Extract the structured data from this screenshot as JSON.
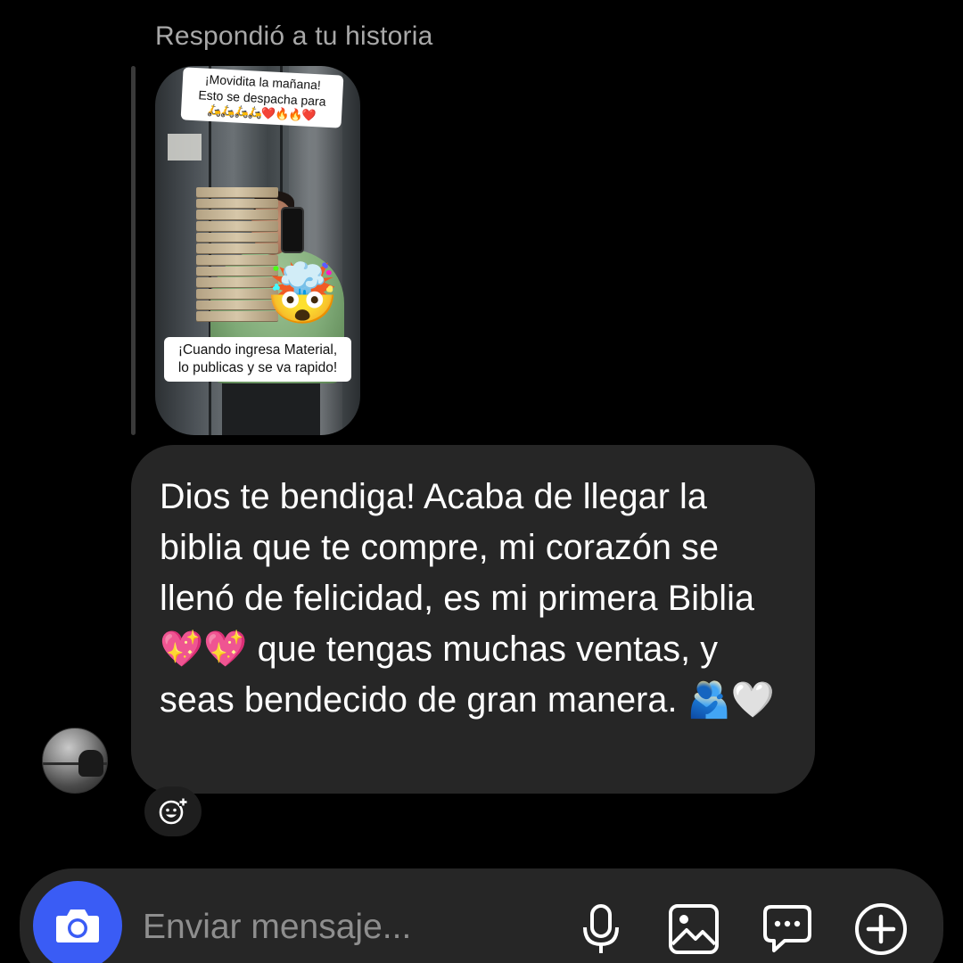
{
  "reply": {
    "header": "Respondió a tu historia"
  },
  "story": {
    "caption_top_line1": "¡Movidita la mañana!",
    "caption_top_line2": "Esto se despacha para",
    "caption_top_emojis": "🛵🛵🛵🛵❤️🔥🔥❤️",
    "caption_bottom_line1": "¡Cuando ingresa Material,",
    "caption_bottom_line2": "lo publicas y se va rapido!",
    "sticker_emoji": "🤯"
  },
  "message": {
    "text": "Dios te bendiga! Acaba de llegar la biblia que te compre, mi corazón se llenó de felicidad, es mi primera Biblia 💖💖 que tengas muchas ventas, y seas bendecido de gran manera. 🫂🤍"
  },
  "composer": {
    "placeholder": "Enviar mensaje..."
  },
  "icons": {
    "camera": "camera-icon",
    "microphone": "microphone-icon",
    "gallery": "gallery-icon",
    "sticker": "chat-bubble-icon",
    "add": "plus-circle-icon",
    "react": "add-reaction-icon"
  },
  "colors": {
    "background": "#000000",
    "bubble": "#262626",
    "accent": "#3a5cf5",
    "muted_text": "#a8a8a8"
  }
}
